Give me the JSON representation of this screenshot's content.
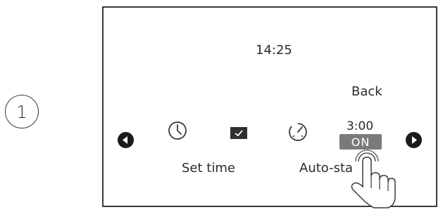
{
  "step": {
    "number": "1"
  },
  "screen": {
    "clock_time": "14:25",
    "back_label": "Back",
    "menu": {
      "items": [
        {
          "label": "Set time",
          "icon": "clock-icon"
        },
        {
          "label": "",
          "icon": "calendar-icon"
        },
        {
          "label": "Auto-sta",
          "icon": "timer-icon"
        }
      ],
      "autostart_time": "3:00",
      "autostart_status": "ON"
    },
    "nav": {
      "left_icon": "chevron-left-icon",
      "right_icon": "chevron-right-icon"
    }
  },
  "colors": {
    "outline": "#3a3a3a",
    "text": "#2b2b2b",
    "badge_background": "#7a7a7a",
    "badge_text": "#ffffff",
    "arrow_fill": "#1b1b1b"
  }
}
